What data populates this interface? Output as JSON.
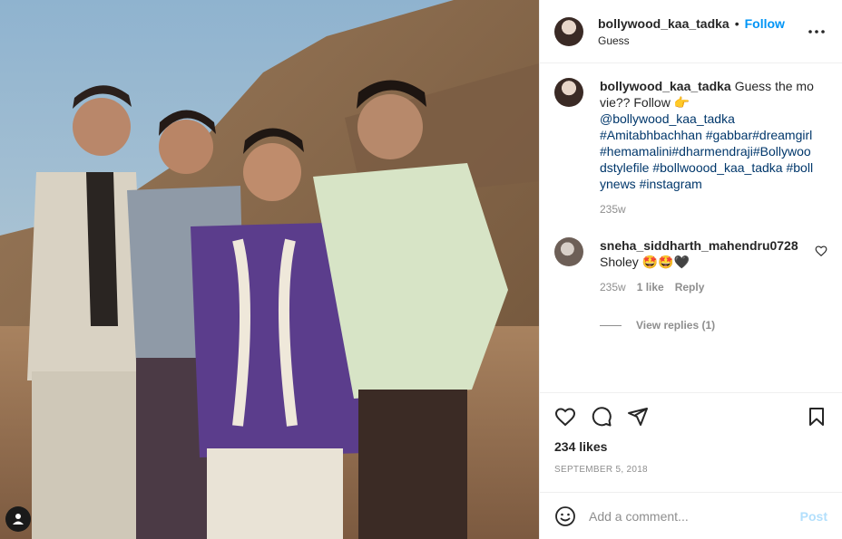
{
  "post": {
    "username": "bollywood_kaa_tadka",
    "follow_label": "Follow",
    "location": "Guess",
    "more_icon": "more-horizontal-icon"
  },
  "caption": {
    "username": "bollywood_kaa_tadka",
    "text_start": "Guess the movie?? Follow",
    "emoji": "👉",
    "mention": "@bollywood_kaa_tadka",
    "hashtags": "#Amitabhbachhan #gabbar#dreamgirl#hemamalini#dharmendraji#Bollywoodstylefile #bollwoood_kaa_tadka #bollynews #instagram",
    "time": "235w"
  },
  "comment": {
    "username": "sneha_siddharth_mahendru0728",
    "text": "Sholey 🤩🤩🖤",
    "time": "235w",
    "likes": "1 like",
    "reply_label": "Reply"
  },
  "view_replies_label": "View replies (1)",
  "likes_label": "234 likes",
  "date_label": "SEPTEMBER 5, 2018",
  "add_comment": {
    "placeholder": "Add a comment...",
    "post_label": "Post"
  },
  "colors": {
    "accent": "#0095f6",
    "post_disabled": "#b2dffc",
    "link": "#00376b",
    "muted": "#8e8e8e"
  },
  "icons": [
    "heart-icon",
    "comment-icon",
    "share-icon",
    "bookmark-icon",
    "emoji-icon",
    "user-tag-icon",
    "like-comment-icon"
  ]
}
